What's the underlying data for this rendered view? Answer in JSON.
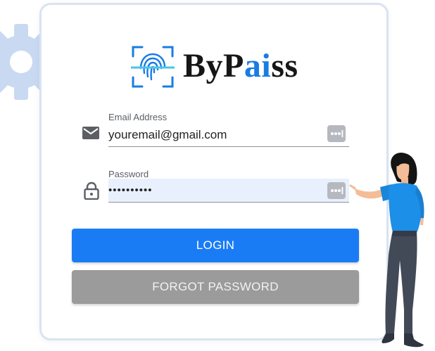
{
  "brand": {
    "name_prefix": "ByP",
    "name_accent": "ai",
    "name_suffix": "ss",
    "accent_color": "#1a7ce3"
  },
  "form": {
    "email": {
      "label": "Email Address",
      "value": "youremail@gmail.com",
      "icon": "envelope-icon"
    },
    "password": {
      "label": "Password",
      "value": "••••••••••",
      "icon": "lock-icon"
    },
    "password_manager_icon": "password-dots-icon"
  },
  "buttons": {
    "login_label": "LOGIN",
    "login_color": "#1a7cf5",
    "forgot_label": "FORGOT PASSWORD",
    "forgot_color": "#9b9b9b"
  },
  "decorations": {
    "background_icon": "gear-icon",
    "illustration": "woman-pointing-illustration"
  }
}
